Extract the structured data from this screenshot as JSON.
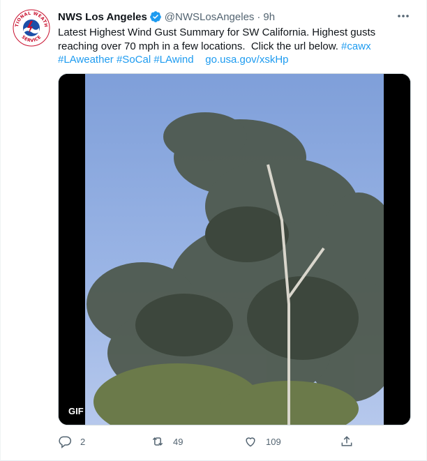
{
  "tweet": {
    "display_name": "NWS Los Angeles",
    "handle": "@NWSLosAngeles",
    "separator": "·",
    "time": "9h",
    "verified": true,
    "more_icon": "more-dots-icon",
    "avatar_text": "NATIONAL WEATHER SERVICE",
    "text": {
      "line1": "Latest Highest Wind Gust Summary for SW California. Highest gusts",
      "line2": "reaching over 70 mph in a few locations.  Click the url below. ",
      "hashtag_cawx": "#cawx",
      "hashtag_laweather": "#LAweather",
      "hashtag_socal": "#SoCal",
      "hashtag_lawind": "#LAwind",
      "link": "go.usa.gov/xskHp"
    },
    "media": {
      "badge": "GIF",
      "icon": "wind-blown-trees-image"
    },
    "actions": {
      "reply_count": "2",
      "retweet_count": "49",
      "like_count": "109"
    }
  },
  "colors": {
    "link": "#1d9bf0",
    "secondary_text": "#536471",
    "primary_text": "#0f1419",
    "verified": "#1d9bf0"
  }
}
